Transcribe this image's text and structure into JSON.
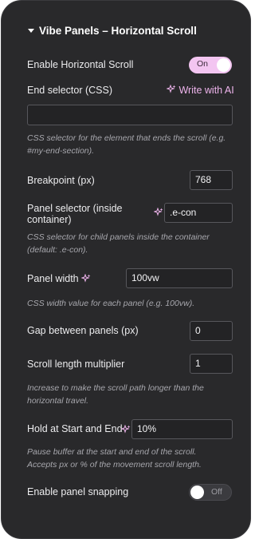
{
  "header": {
    "title": "Vibe Panels – Horizontal Scroll"
  },
  "enable_horizontal_scroll": {
    "label": "Enable Horizontal Scroll",
    "state": "On"
  },
  "end_selector": {
    "label": "End selector (CSS)",
    "ai_label": "Write with AI",
    "value": "",
    "help": "CSS selector for the element that ends the scroll (e.g. #my-end-section)."
  },
  "breakpoint": {
    "label": "Breakpoint (px)",
    "value": "768"
  },
  "panel_selector": {
    "label_line1": "Panel selector (inside",
    "label_line2": "container)",
    "value": ".e-con",
    "help": "CSS selector for child panels inside the container (default: .e-con)."
  },
  "panel_width": {
    "label": "Panel width",
    "value": "100vw",
    "help": "CSS width value for each panel (e.g. 100vw)."
  },
  "gap": {
    "label": "Gap between panels (px)",
    "value": "0"
  },
  "scroll_multiplier": {
    "label": "Scroll length multiplier",
    "value": "1",
    "help": "Increase to make the scroll path longer than the horizontal travel."
  },
  "hold": {
    "label": "Hold at Start and End",
    "value": "10%",
    "help": "Pause buffer at the start and end of the scroll. Accepts px or % of the movement scroll length."
  },
  "snapping": {
    "label": "Enable panel snapping",
    "state": "Off"
  },
  "icons": {
    "collapse": "caret-down-icon",
    "ai": "sparkle-icon"
  },
  "colors": {
    "panel_bg": "#29292b",
    "accent": "#eeb4ec",
    "toggle_on": "#f3c5f1"
  }
}
